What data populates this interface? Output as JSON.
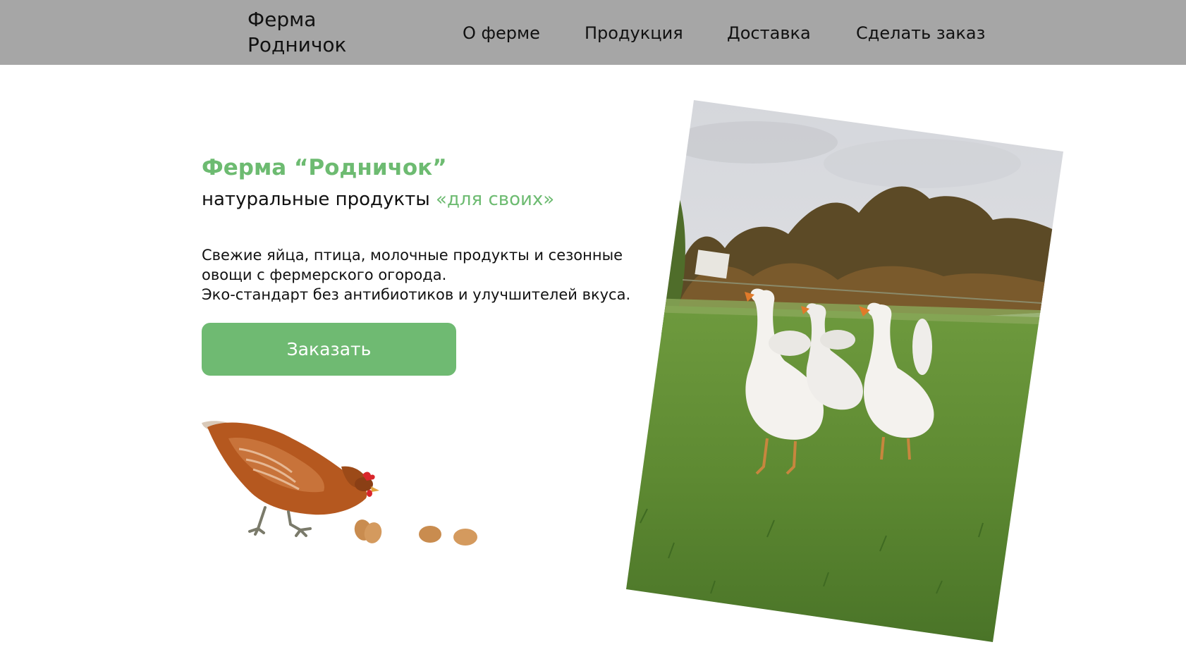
{
  "header": {
    "logo": "Ферма\nРодничок",
    "logo_line1": "Ферма",
    "logo_line2": "Родничок",
    "nav": {
      "about": "О ферме",
      "products": "Продукция",
      "delivery": "Доставка",
      "order": "Сделать заказ"
    },
    "background_color": "#a6a6a6"
  },
  "hero": {
    "title": "Ферма “Родничок”",
    "subtitle_main": "натуральные продукты ",
    "subtitle_accent": "«для своих»",
    "description_line1": "Свежие яйца, птица, молочные продукты и сезонные овощи с фермерского огорода.",
    "description_line2": "Эко-стандарт без антибиотиков и улучшителей вкуса.",
    "button_label": "Заказать",
    "accent_color": "#6dbb71"
  },
  "images": {
    "hen": "hen-with-eggs-illustration",
    "photo": "geese-in-meadow-photo"
  }
}
